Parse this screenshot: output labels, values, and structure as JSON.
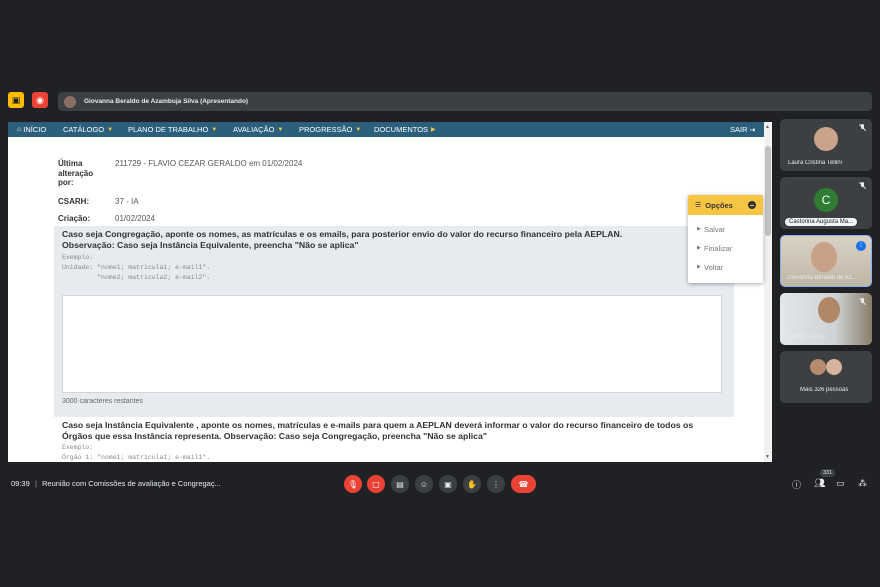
{
  "presenter": {
    "name": "Giovanna Beraldo de Azambuja Silva (Apresentando)"
  },
  "nav": {
    "items": [
      {
        "label": "INÍCIO",
        "icon": "home-icon"
      },
      {
        "label": "CATÁLOGO"
      },
      {
        "label": "PLANO DE TRABALHO"
      },
      {
        "label": "AVALIAÇÃO"
      },
      {
        "label": "PROGRESSÃO"
      },
      {
        "label": "DOCUMENTOS"
      }
    ],
    "logout": "SAIR"
  },
  "meta": {
    "last_change_label": "Última alteração por:",
    "last_change_value": "211729 - FLAVIO CEZAR GERALDO em 01/02/2024",
    "csarh_label": "CSARH:",
    "csarh_value": "37 - IA",
    "created_label": "Criação:",
    "created_value": "01/02/2024"
  },
  "question1": {
    "title_line1": "Caso seja Congregação, aponte os nomes, as matrículas e os emails, para posterior envio do valor do recurso financeiro pela AEPLAN.",
    "title_line2": "Observação: Caso seja Instância Equivalente, preencha \"Não se aplica\"",
    "example_line1": "Exemplo:",
    "example_line2": "Unidade: \"nome1; matricula1; e-mail1\".",
    "example_line3": "         \"nome2; matricula2; e-mail2\".",
    "chars_left": "3000 caracteres restantes"
  },
  "question2": {
    "title": "Caso seja Instância Equivalente , aponte os nomes, matrículas e e-mails para quem a AEPLAN deverá informar o valor do recurso financeiro de todos os Órgãos que essa Instância representa.  Observação: Caso seja Congregação, preencha \"Não se aplica\"",
    "example_line1": "Exemplo:",
    "example_line2": "Órgão 1: \"nome1; matricula1; e-mail1\"."
  },
  "options": {
    "title": "Opções",
    "items": [
      "Salvar",
      "Finalizar",
      "Voltar"
    ]
  },
  "participants": [
    {
      "name": "Laura Cristina Tellini"
    },
    {
      "name": "Castorina Augusta Ma...",
      "initial": "C"
    },
    {
      "name": "Giovanna Beraldo de Az..."
    },
    {
      "name": "Rodrigo Lanna"
    },
    {
      "name": "Mais 326 pessoas"
    }
  ],
  "bottom": {
    "time": "09:39",
    "meeting": "Reunião com Comissões de avaliação e Congregaç...",
    "people_count": "331"
  },
  "colors": {
    "nav": "#2c5f7c",
    "accent": "#f6c544",
    "danger": "#ea4335"
  }
}
